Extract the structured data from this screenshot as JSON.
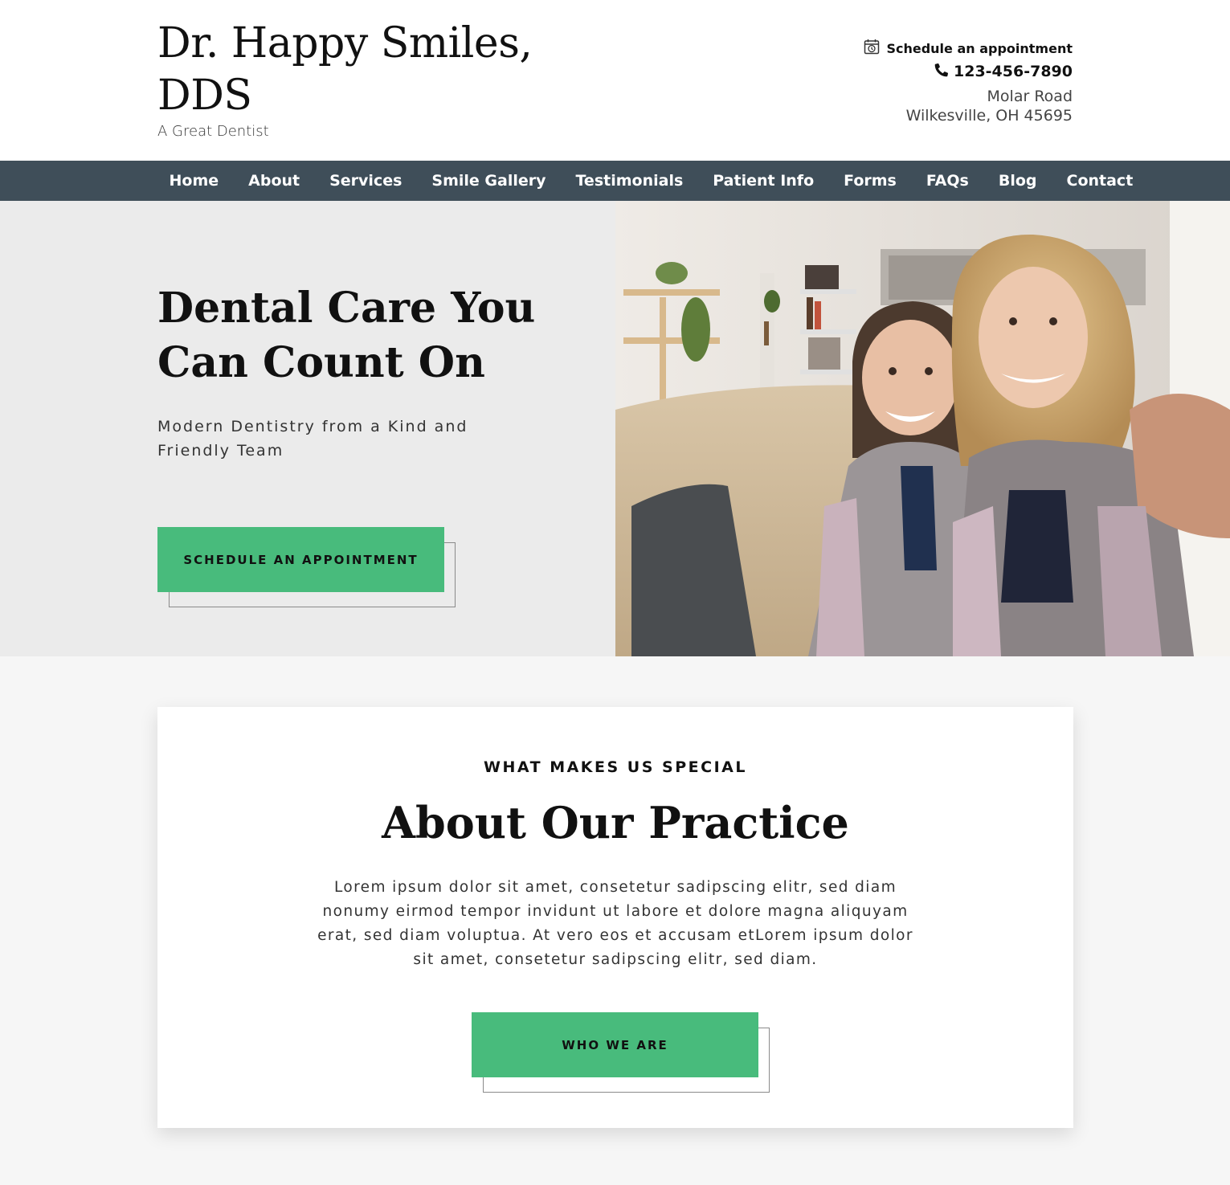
{
  "header": {
    "site_title": "Dr. Happy Smiles, DDS",
    "tagline": "A Great Dentist",
    "appointment_label": "Schedule an appointment",
    "phone": "123-456-7890",
    "address_line1": "Molar Road",
    "address_line2": "Wilkesville, OH 45695"
  },
  "nav": {
    "items": [
      "Home",
      "About",
      "Services",
      "Smile Gallery",
      "Testimonials",
      "Patient Info",
      "Forms",
      "FAQs",
      "Blog",
      "Contact"
    ],
    "background": "#3f4e59"
  },
  "hero": {
    "title": "Dental Care You Can Count On",
    "subtitle": "Modern Dentistry from a Kind and Friendly Team",
    "button_label": "SCHEDULE AN APPOINTMENT",
    "photo": "mother-and-daughter-selfie-photo"
  },
  "about": {
    "eyebrow": "WHAT MAKES US SPECIAL",
    "title": "About Our Practice",
    "body": "Lorem ipsum dolor sit amet, consetetur sadipscing elitr, sed diam nonumy eirmod tempor invidunt ut labore et dolore magna aliquyam erat, sed diam voluptua. At vero eos et accusam etLorem ipsum dolor sit amet, consetetur sadipscing elitr, sed diam.",
    "button_label": "WHO WE ARE"
  },
  "colors": {
    "accent": "#48bb7c",
    "hero_background": "#ebebeb",
    "page_background": "#f6f6f6"
  },
  "icons": {
    "appointment": "calendar-clock-icon",
    "phone": "phone-icon"
  }
}
